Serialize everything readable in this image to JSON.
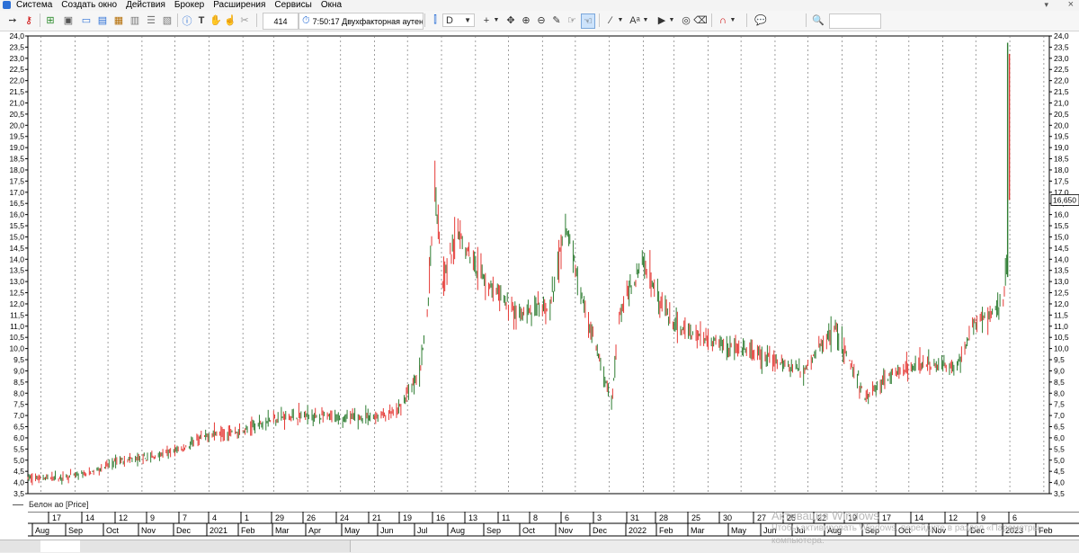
{
  "menu": {
    "items": [
      "Система",
      "Создать окно",
      "Действия",
      "Брокер",
      "Расширения",
      "Сервисы",
      "Окна"
    ]
  },
  "toolbar": {
    "counter": "414",
    "clock_text": "7:50:17  Двухфакторная аутен",
    "period": "D",
    "search_value": ""
  },
  "instrument": {
    "legend_label": "Белон ао [Price]",
    "last_price": "16,650",
    "up_color": "#2e7d32",
    "down_color": "#e53935"
  },
  "time_axis": {
    "days": [
      "17",
      "14",
      "12",
      "9",
      "7",
      "4",
      "1",
      "29",
      "26",
      "24",
      "21",
      "19",
      "16",
      "13",
      "11",
      "8",
      "6",
      "3",
      "31",
      "28",
      "25",
      "30",
      "27",
      "25",
      "22",
      "19",
      "17",
      "14",
      "12",
      "9",
      "6"
    ],
    "months": [
      "Aug",
      "Sep",
      "Oct",
      "Nov",
      "Dec",
      "2021",
      "Feb",
      "Mar",
      "Apr",
      "May",
      "Jun",
      "Jul",
      "Aug",
      "Sep",
      "Oct",
      "Nov",
      "Dec",
      "2022",
      "Feb",
      "Mar",
      "May",
      "Jun",
      "Jul",
      "Aug",
      "Sep",
      "Oct",
      "Nov",
      "Dec",
      "2023",
      "Feb"
    ]
  },
  "watermark": {
    "line1": "Активация Windows",
    "line2": "Чтобы активировать Windows, перейдите в раздел «Параметры»",
    "line3": "компьютера."
  },
  "chart_data": {
    "type": "candlestick",
    "instrument": "Белон ао [Price]",
    "frequency": "D",
    "ylim": [
      3.5,
      24.0
    ],
    "ytick_step": 0.5,
    "x_range": [
      "2020-07-20",
      "2023-02-06"
    ],
    "last_value": 16.65,
    "series": [
      {
        "name": "Белон ао [Price]",
        "x": [
          "2020-07-20",
          "2020-08-17",
          "2020-09-14",
          "2020-10-12",
          "2020-11-09",
          "2020-12-07",
          "2021-01-04",
          "2021-02-01",
          "2021-03-01",
          "2021-03-29",
          "2021-04-26",
          "2021-05-24",
          "2021-06-21",
          "2021-07-12",
          "2021-07-19",
          "2021-07-26",
          "2021-08-02",
          "2021-08-16",
          "2021-09-13",
          "2021-10-11",
          "2021-11-08",
          "2021-11-22",
          "2021-12-06",
          "2022-01-03",
          "2022-01-10",
          "2022-01-31",
          "2022-02-28",
          "2022-03-28",
          "2022-04-25",
          "2022-05-30",
          "2022-06-27",
          "2022-07-25",
          "2022-08-22",
          "2022-09-19",
          "2022-10-17",
          "2022-11-14",
          "2022-11-28",
          "2022-12-12",
          "2022-12-19",
          "2022-12-26",
          "2023-01-02"
        ],
        "values": [
          4.2,
          4.2,
          4.4,
          5.0,
          5.1,
          5.5,
          6.2,
          6.3,
          6.9,
          7.0,
          6.9,
          6.9,
          7.1,
          8.9,
          11.5,
          17.5,
          13.0,
          15.2,
          12.8,
          11.5,
          11.8,
          15.5,
          12.5,
          7.5,
          11.5,
          14.0,
          11.0,
          10.5,
          10.0,
          9.5,
          9.0,
          11.0,
          7.8,
          9.0,
          9.3,
          9.2,
          11.0,
          11.5,
          11.8,
          12.0,
          16.65
        ]
      }
    ]
  }
}
